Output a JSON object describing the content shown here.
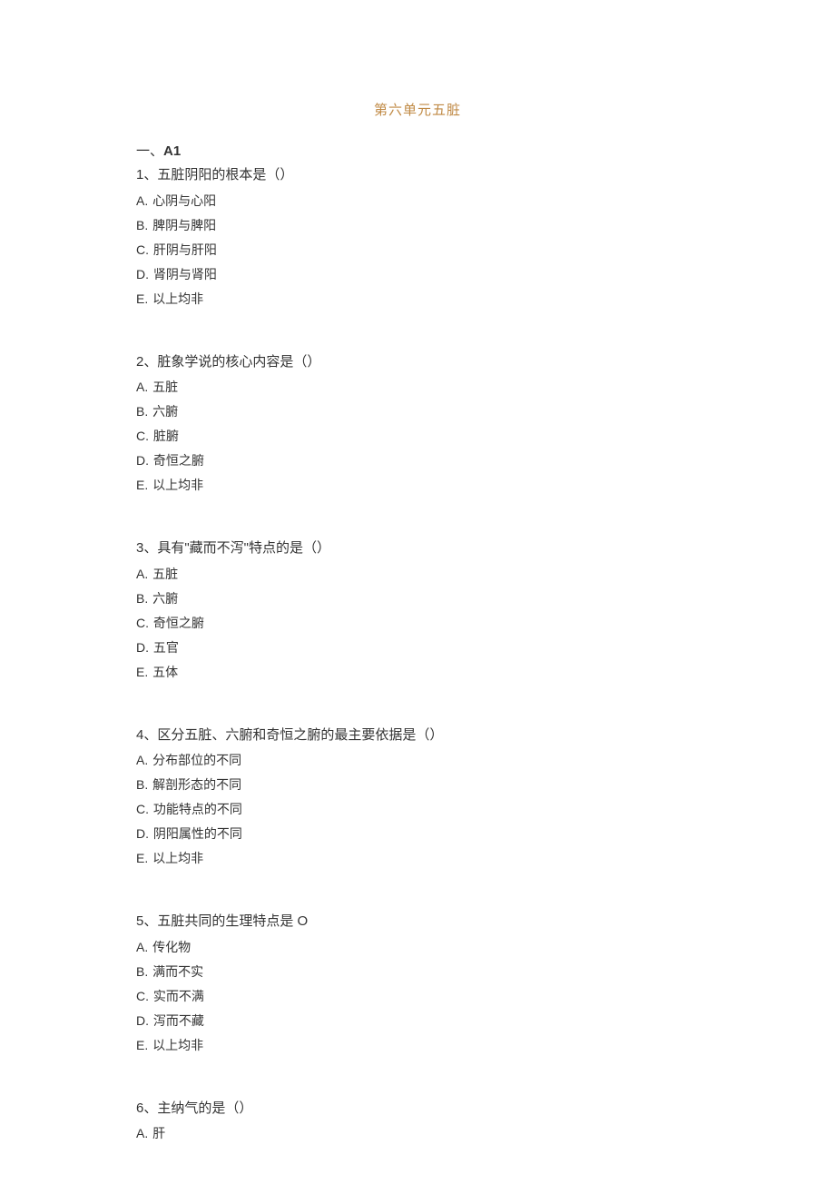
{
  "title": "第六单元五脏",
  "section_label_prefix": "一、",
  "section_label_main": "A1",
  "questions": [
    {
      "num": "1",
      "stem": "、五脏阴阳的根本是（）",
      "options": [
        {
          "letter": "A.",
          "text": "心阴与心阳"
        },
        {
          "letter": "B.",
          "text": "脾阴与脾阳"
        },
        {
          "letter": "C.",
          "text": "肝阴与肝阳"
        },
        {
          "letter": "D.",
          "text": "肾阴与肾阳"
        },
        {
          "letter": "E.",
          "text": "以上均非"
        }
      ]
    },
    {
      "num": "2",
      "stem": "、脏象学说的核心内容是（）",
      "options": [
        {
          "letter": "A.",
          "text": "五脏"
        },
        {
          "letter": "B.",
          "text": "六腑"
        },
        {
          "letter": "C.",
          "text": "脏腑"
        },
        {
          "letter": "D.",
          "text": "奇恒之腑"
        },
        {
          "letter": "E.",
          "text": "以上均非"
        }
      ]
    },
    {
      "num": "3",
      "stem": "、具有\"藏而不泻\"特点的是（）",
      "options": [
        {
          "letter": "A.",
          "text": "五脏"
        },
        {
          "letter": "B.",
          "text": "六腑"
        },
        {
          "letter": "C.",
          "text": "奇恒之腑"
        },
        {
          "letter": "D.",
          "text": "五官"
        },
        {
          "letter": "E.",
          "text": "五体"
        }
      ]
    },
    {
      "num": "4",
      "stem": "、区分五脏、六腑和奇恒之腑的最主要依据是（）",
      "options": [
        {
          "letter": "A.",
          "text": "分布部位的不同"
        },
        {
          "letter": "B.",
          "text": "解剖形态的不同"
        },
        {
          "letter": "C.",
          "text": "功能特点的不同"
        },
        {
          "letter": "D.",
          "text": "阴阳属性的不同"
        },
        {
          "letter": "E.",
          "text": "以上均非"
        }
      ]
    },
    {
      "num": "5",
      "stem": "、五脏共同的生理特点是 O",
      "options": [
        {
          "letter": "A.",
          "text": "传化物"
        },
        {
          "letter": "B.",
          "text": "满而不实"
        },
        {
          "letter": "C.",
          "text": "实而不满"
        },
        {
          "letter": "D.",
          "text": "泻而不藏"
        },
        {
          "letter": "E.",
          "text": "以上均非"
        }
      ]
    },
    {
      "num": "6",
      "stem": "、主纳气的是（）",
      "options": [
        {
          "letter": "A.",
          "text": "肝"
        }
      ]
    }
  ]
}
